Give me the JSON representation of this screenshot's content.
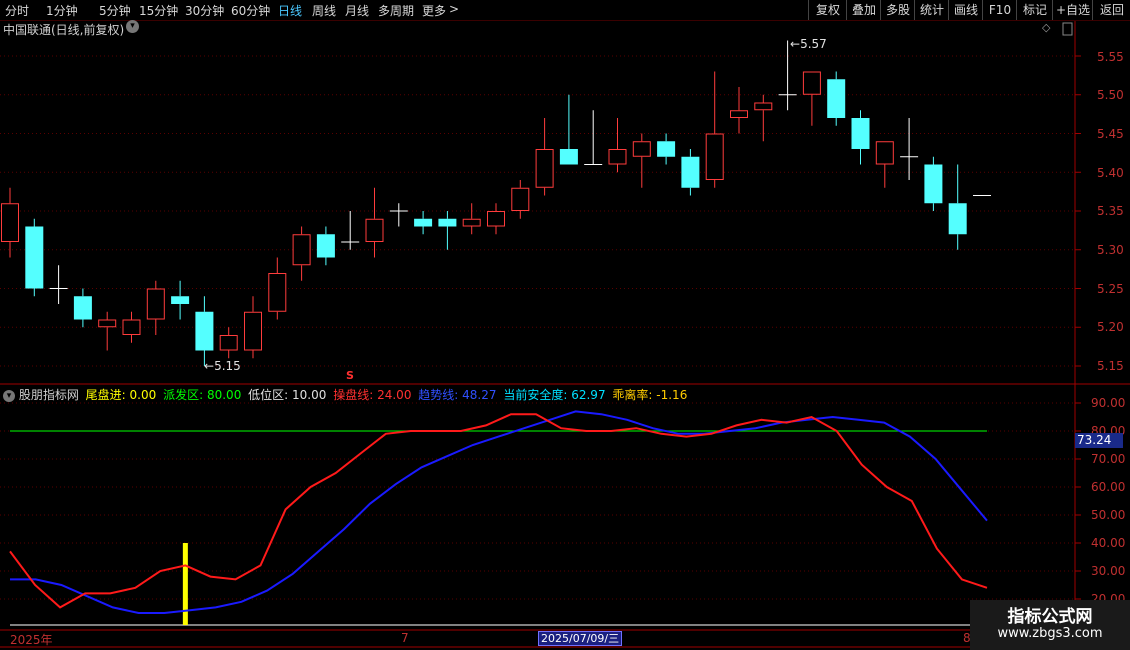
{
  "toolbar": {
    "periods": [
      {
        "label": "分时",
        "active": false
      },
      {
        "label": "1分钟",
        "active": false
      },
      {
        "label": "5分钟",
        "active": false
      },
      {
        "label": "15分钟",
        "active": false
      },
      {
        "label": "30分钟",
        "active": false
      },
      {
        "label": "60分钟",
        "active": false
      },
      {
        "label": "日线",
        "active": true
      },
      {
        "label": "周线",
        "active": false
      },
      {
        "label": "月线",
        "active": false
      },
      {
        "label": "多周期",
        "active": false
      },
      {
        "label": "更多",
        "active": false
      }
    ],
    "more_arrow": ">",
    "right_buttons": [
      "复权",
      "叠加",
      "多股",
      "统计",
      "画线",
      "F10",
      "标记",
      "+自选",
      "返回"
    ]
  },
  "stock": {
    "title": "中国联通(日线,前复权)",
    "high_label": "5.57",
    "low_label": "5.15",
    "marker": "S"
  },
  "price_axis": {
    "ticks": [
      "5.55",
      "5.50",
      "5.45",
      "5.40",
      "5.35",
      "5.30",
      "5.25",
      "5.20",
      "5.15"
    ]
  },
  "indicator": {
    "name": "股朋指标网",
    "items": [
      {
        "label": "尾盘进:",
        "value": "0.00",
        "color": "#ffff00"
      },
      {
        "label": "派发区:",
        "value": "80.00",
        "color": "#00ff00"
      },
      {
        "label": "低位区:",
        "value": "10.00",
        "color": "#e0e0e0"
      },
      {
        "label": "操盘线:",
        "value": "24.00",
        "color": "#ff3030"
      },
      {
        "label": "趋势线:",
        "value": "48.27",
        "color": "#3050ff"
      },
      {
        "label": "当前安全度:",
        "value": "62.97",
        "color": "#00e0ff"
      },
      {
        "label": "乖离率:",
        "value": "-1.16",
        "color": "#ffcc00"
      }
    ],
    "axis_ticks": [
      "90.00",
      "80.00",
      "70.00",
      "60.00",
      "50.00",
      "40.00",
      "30.00",
      "20.00"
    ],
    "current_value_badge": "73.24"
  },
  "date_axis": {
    "labels": [
      {
        "text": "2025年",
        "highlight": false
      },
      {
        "text": "7",
        "highlight": false
      },
      {
        "text": "2025/07/09/三",
        "highlight": true
      },
      {
        "text": "8",
        "highlight": false
      }
    ]
  },
  "watermark": {
    "title": "指标公式网",
    "url": "www.zbgs3.com"
  },
  "colors": {
    "up": "#ff3c3c",
    "down": "#54ffff",
    "axis": "#a00000",
    "operation_line": "#ff1a1a",
    "trend_line": "#1a1aff",
    "distribution_line": "#00d000",
    "signal_bar": "#ffff00"
  },
  "chart_data": [
    {
      "type": "candlestick",
      "title": "中国联通(日线,前复权)",
      "ylim": [
        5.13,
        5.59
      ],
      "candles": [
        {
          "o": 5.31,
          "c": 5.36,
          "h": 5.38,
          "l": 5.29
        },
        {
          "o": 5.33,
          "c": 5.25,
          "h": 5.34,
          "l": 5.24
        },
        {
          "o": 5.25,
          "c": 5.25,
          "h": 5.28,
          "l": 5.23
        },
        {
          "o": 5.24,
          "c": 5.21,
          "h": 5.25,
          "l": 5.2
        },
        {
          "o": 5.2,
          "c": 5.21,
          "h": 5.22,
          "l": 5.17
        },
        {
          "o": 5.19,
          "c": 5.21,
          "h": 5.22,
          "l": 5.18
        },
        {
          "o": 5.21,
          "c": 5.25,
          "h": 5.26,
          "l": 5.19
        },
        {
          "o": 5.24,
          "c": 5.23,
          "h": 5.26,
          "l": 5.21
        },
        {
          "o": 5.22,
          "c": 5.17,
          "h": 5.24,
          "l": 5.15
        },
        {
          "o": 5.17,
          "c": 5.19,
          "h": 5.2,
          "l": 5.16
        },
        {
          "o": 5.17,
          "c": 5.22,
          "h": 5.24,
          "l": 5.16
        },
        {
          "o": 5.22,
          "c": 5.27,
          "h": 5.29,
          "l": 5.21
        },
        {
          "o": 5.28,
          "c": 5.32,
          "h": 5.33,
          "l": 5.26
        },
        {
          "o": 5.32,
          "c": 5.29,
          "h": 5.33,
          "l": 5.28
        },
        {
          "o": 5.31,
          "c": 5.31,
          "h": 5.35,
          "l": 5.3
        },
        {
          "o": 5.31,
          "c": 5.34,
          "h": 5.38,
          "l": 5.29
        },
        {
          "o": 5.35,
          "c": 5.35,
          "h": 5.36,
          "l": 5.33
        },
        {
          "o": 5.34,
          "c": 5.33,
          "h": 5.35,
          "l": 5.32
        },
        {
          "o": 5.34,
          "c": 5.33,
          "h": 5.35,
          "l": 5.3
        },
        {
          "o": 5.33,
          "c": 5.34,
          "h": 5.36,
          "l": 5.32
        },
        {
          "o": 5.33,
          "c": 5.35,
          "h": 5.36,
          "l": 5.32
        },
        {
          "o": 5.35,
          "c": 5.38,
          "h": 5.39,
          "l": 5.34
        },
        {
          "o": 5.38,
          "c": 5.43,
          "h": 5.47,
          "l": 5.37
        },
        {
          "o": 5.43,
          "c": 5.41,
          "h": 5.5,
          "l": 5.41
        },
        {
          "o": 5.41,
          "c": 5.41,
          "h": 5.48,
          "l": 5.41
        },
        {
          "o": 5.41,
          "c": 5.43,
          "h": 5.47,
          "l": 5.4
        },
        {
          "o": 5.42,
          "c": 5.44,
          "h": 5.45,
          "l": 5.38
        },
        {
          "o": 5.44,
          "c": 5.42,
          "h": 5.45,
          "l": 5.41
        },
        {
          "o": 5.42,
          "c": 5.38,
          "h": 5.43,
          "l": 5.37
        },
        {
          "o": 5.39,
          "c": 5.45,
          "h": 5.53,
          "l": 5.38
        },
        {
          "o": 5.47,
          "c": 5.48,
          "h": 5.51,
          "l": 5.45
        },
        {
          "o": 5.48,
          "c": 5.49,
          "h": 5.5,
          "l": 5.44
        },
        {
          "o": 5.5,
          "c": 5.5,
          "h": 5.57,
          "l": 5.48
        },
        {
          "o": 5.5,
          "c": 5.53,
          "h": 5.53,
          "l": 5.46
        },
        {
          "o": 5.52,
          "c": 5.47,
          "h": 5.53,
          "l": 5.46
        },
        {
          "o": 5.47,
          "c": 5.43,
          "h": 5.48,
          "l": 5.41
        },
        {
          "o": 5.41,
          "c": 5.44,
          "h": 5.44,
          "l": 5.38
        },
        {
          "o": 5.42,
          "c": 5.42,
          "h": 5.47,
          "l": 5.39
        },
        {
          "o": 5.41,
          "c": 5.36,
          "h": 5.42,
          "l": 5.35
        },
        {
          "o": 5.36,
          "c": 5.32,
          "h": 5.41,
          "l": 5.3
        },
        {
          "o": 5.37,
          "c": 5.37,
          "h": 5.37,
          "l": 5.37
        }
      ]
    },
    {
      "type": "line",
      "ylim": [
        15,
        95
      ],
      "series": [
        {
          "name": "操盘线",
          "values": [
            37,
            25,
            17,
            22,
            22,
            24,
            30,
            32,
            28,
            27,
            32,
            52,
            60,
            65,
            72,
            79,
            80,
            80,
            80,
            82,
            86,
            86,
            81,
            80,
            80,
            81,
            79,
            78,
            79,
            82,
            84,
            83,
            85,
            80,
            68,
            60,
            55,
            38,
            27,
            24
          ]
        },
        {
          "name": "趋势线",
          "values": [
            27,
            27,
            25,
            21,
            17,
            15,
            15,
            16,
            17,
            19,
            23,
            29,
            37,
            45,
            54,
            61,
            67,
            71,
            75,
            78,
            81,
            84,
            87,
            86,
            84,
            81,
            79,
            79,
            80,
            81,
            83,
            84,
            85,
            84,
            83,
            78,
            70,
            59,
            48
          ]
        },
        {
          "name": "派发区",
          "values": [
            80
          ]
        },
        {
          "name": "尾盘进",
          "values": [
            {
              "index": 7,
              "value": 40
            }
          ]
        }
      ]
    }
  ]
}
